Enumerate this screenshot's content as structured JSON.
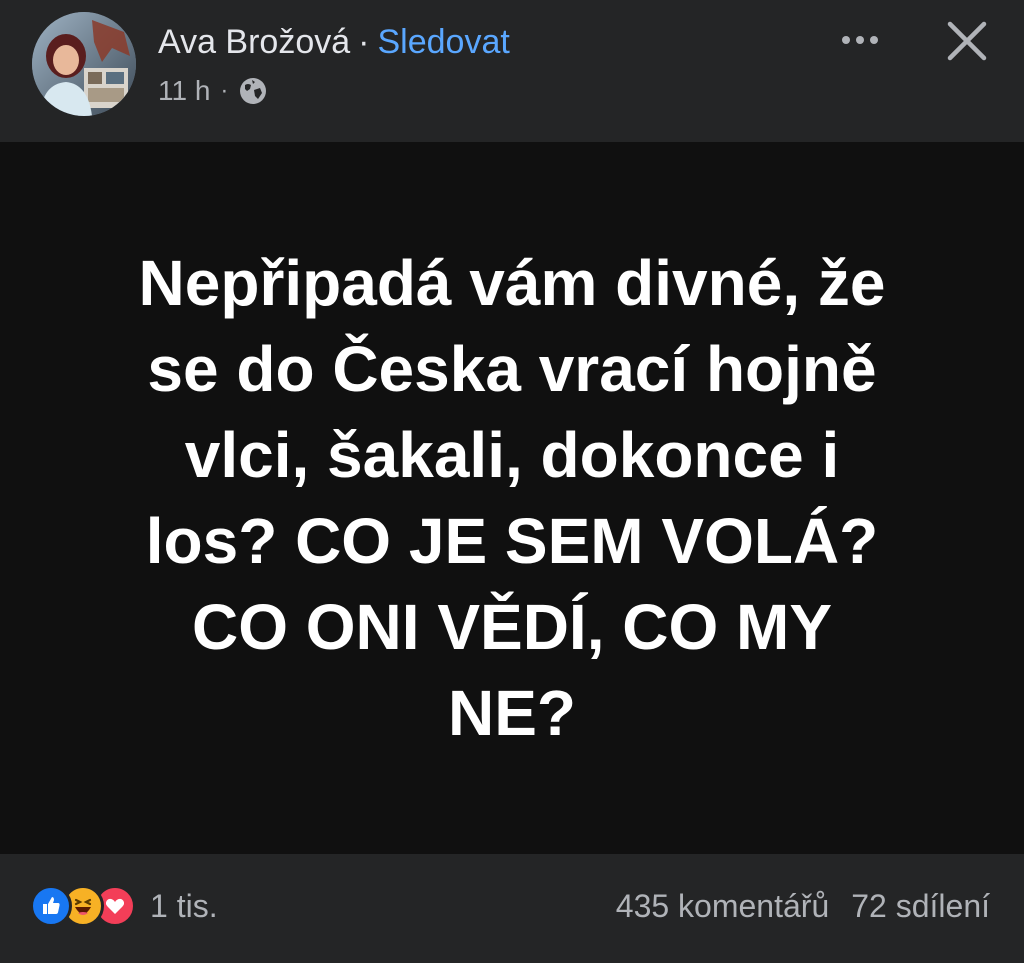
{
  "header": {
    "author_name": "Ava Brožová",
    "separator": "·",
    "follow_label": "Sledovat",
    "timestamp": "11 h",
    "meta_separator": "·",
    "audience_icon": "globe-icon",
    "more_icon": "more-horizontal-icon",
    "close_icon": "close-icon"
  },
  "post": {
    "text": "Nepřipadá vám divné, že\nse do Česka vrací hojně\nvlci, šakali, dokonce i\nlos? CO JE SEM VOLÁ?\nCO ONI VĚDÍ, CO MY\nNE?",
    "background_color": "#101010",
    "text_color": "#ffffff"
  },
  "footer": {
    "reaction_icons": [
      "like-icon",
      "haha-icon",
      "love-icon"
    ],
    "reaction_count": "1 tis.",
    "comments": "435 komentářů",
    "shares": "72 sdílení"
  },
  "colors": {
    "accent": "#5aa7ff",
    "like": "#1877f2",
    "haha": "#f7b125",
    "love": "#f33e58"
  }
}
